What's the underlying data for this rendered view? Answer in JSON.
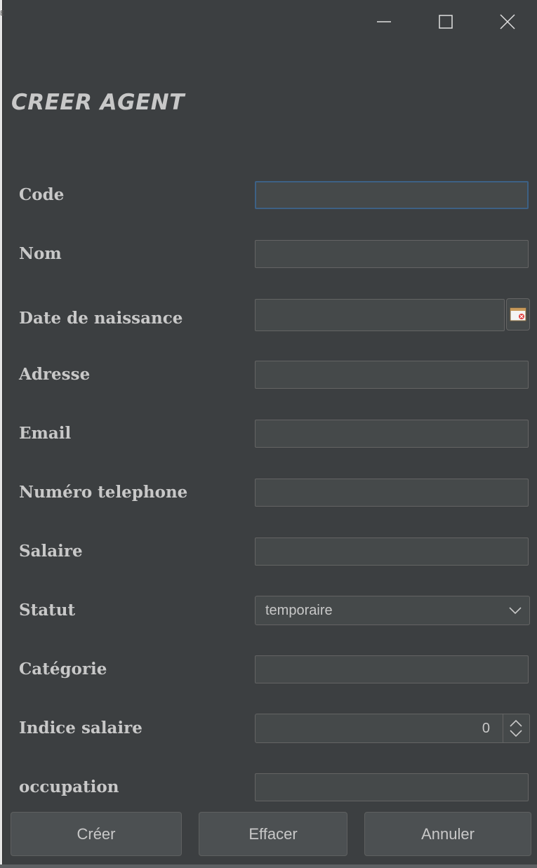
{
  "window": {
    "edge_mark": "E",
    "controls": [
      "minimize",
      "maximize",
      "close"
    ]
  },
  "page_title": "CREER AGENT",
  "form": {
    "fields": [
      {
        "label": "Code",
        "value": ""
      },
      {
        "label": "Nom",
        "value": ""
      },
      {
        "label": "Date de naissance",
        "value": ""
      },
      {
        "label": "Adresse",
        "value": ""
      },
      {
        "label": "Email",
        "value": ""
      },
      {
        "label": "Numéro telephone",
        "value": ""
      },
      {
        "label": "Salaire",
        "value": ""
      },
      {
        "label": "Statut",
        "value": "temporaire"
      },
      {
        "label": "Catégorie",
        "value": ""
      },
      {
        "label": "Indice salaire",
        "value": "0"
      },
      {
        "label": "occupation",
        "value": ""
      }
    ]
  },
  "buttons": {
    "create": "Créer",
    "clear": "Effacer",
    "cancel": "Annuler"
  },
  "colors": {
    "background": "#3c3f41",
    "field_bg": "#45494a",
    "focus_border": "#3d6185",
    "text": "#c8c8c8"
  }
}
